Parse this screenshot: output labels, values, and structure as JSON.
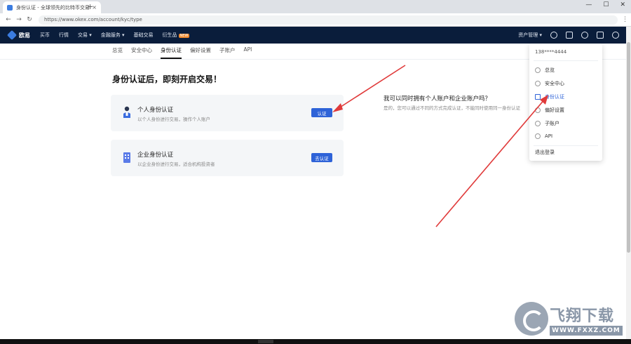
{
  "browser": {
    "tab_title": "身份认证 - 全球领先的比特币交易",
    "tab_close": "×",
    "new_tab": "+",
    "url": "https://www.okex.com/account/kyc/type",
    "win_min": "—",
    "win_max": "☐",
    "win_close": "✕"
  },
  "site": {
    "brand": "欧易",
    "nav": [
      "买币",
      "行情",
      "交易 ▾",
      "金融服务 ▾",
      "基础交易",
      "衍生品"
    ],
    "nav_badge": "NEW",
    "account_label": "资产管理 ▾"
  },
  "subnav": {
    "items": [
      "总览",
      "安全中心",
      "身份认证",
      "偏好设置",
      "子账户",
      "API"
    ],
    "active_index": 2
  },
  "main": {
    "title": "身份认证后，即刻开启交易！",
    "personal": {
      "title": "个人身份认证",
      "desc": "以个人身份进行交易，操作个人账户",
      "button": "认证"
    },
    "enterprise": {
      "title": "企业身份认证",
      "desc": "以企业身份进行交易，适合机构投资者",
      "button": "去认证"
    },
    "faq": {
      "question": "我可以同时拥有个人账户和企业账户吗？",
      "answer": "是的，您可以通过不同的方式完成认证，不能同时使用同一身份认证"
    }
  },
  "dropdown": {
    "user": "138****4444",
    "items": [
      "总览",
      "安全中心",
      "身份认证",
      "偏好设置",
      "子账户",
      "API"
    ],
    "selected_index": 2,
    "logout": "退出登录"
  },
  "watermark": {
    "text": "飞翔下载",
    "url": "WWW.FXXZ.COM"
  },
  "colors": {
    "header_bg": "#0a1d3b",
    "accent": "#2e63d8",
    "arrow": "#e03a3a"
  }
}
